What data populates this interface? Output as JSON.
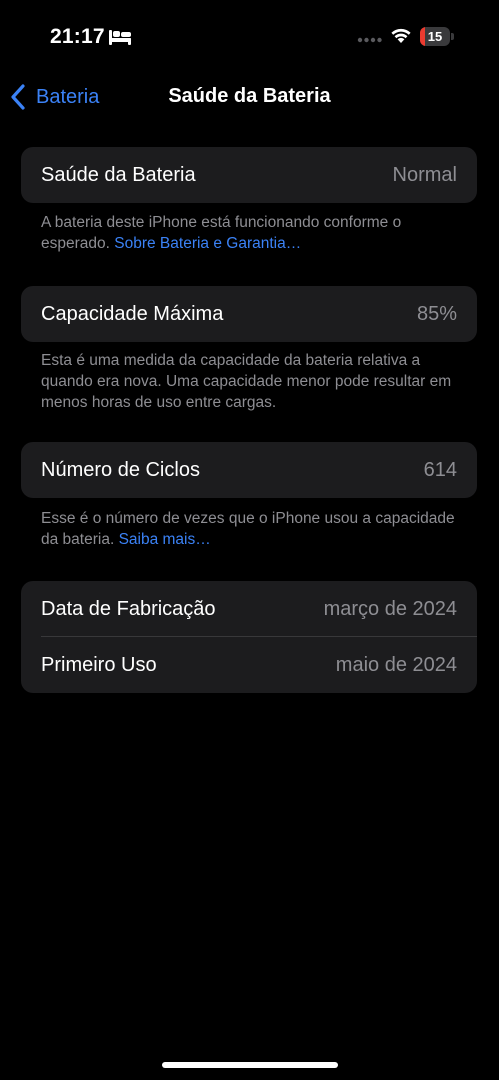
{
  "status_bar": {
    "time": "21:17",
    "battery_level": "15",
    "battery_fraction": 0.15,
    "icons": [
      "bed-icon",
      "cellular-signal-icon",
      "wifi-icon",
      "battery-icon"
    ]
  },
  "nav": {
    "back_label": "Bateria",
    "title": "Saúde da Bateria"
  },
  "sections": {
    "health": {
      "label": "Saúde da Bateria",
      "value": "Normal",
      "footnote": "A bateria deste iPhone está funcionando conforme o esperado.",
      "footnote_link": "Sobre Bateria e Garantia…"
    },
    "capacity": {
      "label": "Capacidade Máxima",
      "value": "85%",
      "footnote": "Esta é uma medida da capacidade da bateria relativa a quando era nova. Uma capacidade menor pode resultar em menos horas de uso entre cargas."
    },
    "cycles": {
      "label": "Número de Ciclos",
      "value": "614",
      "footnote": "Esse é o número de vezes que o iPhone usou a capacidade da bateria.",
      "footnote_link": "Saiba mais…"
    },
    "dates": {
      "manufacture_label": "Data de Fabricação",
      "manufacture_value": "março de 2024",
      "first_use_label": "Primeiro Uso",
      "first_use_value": "maio de 2024"
    }
  },
  "colors": {
    "background": "#000000",
    "cell": "#1c1c1e",
    "accent": "#3b82f6",
    "secondary_text": "#8e8e93",
    "battery_low": "#eb3b30"
  }
}
